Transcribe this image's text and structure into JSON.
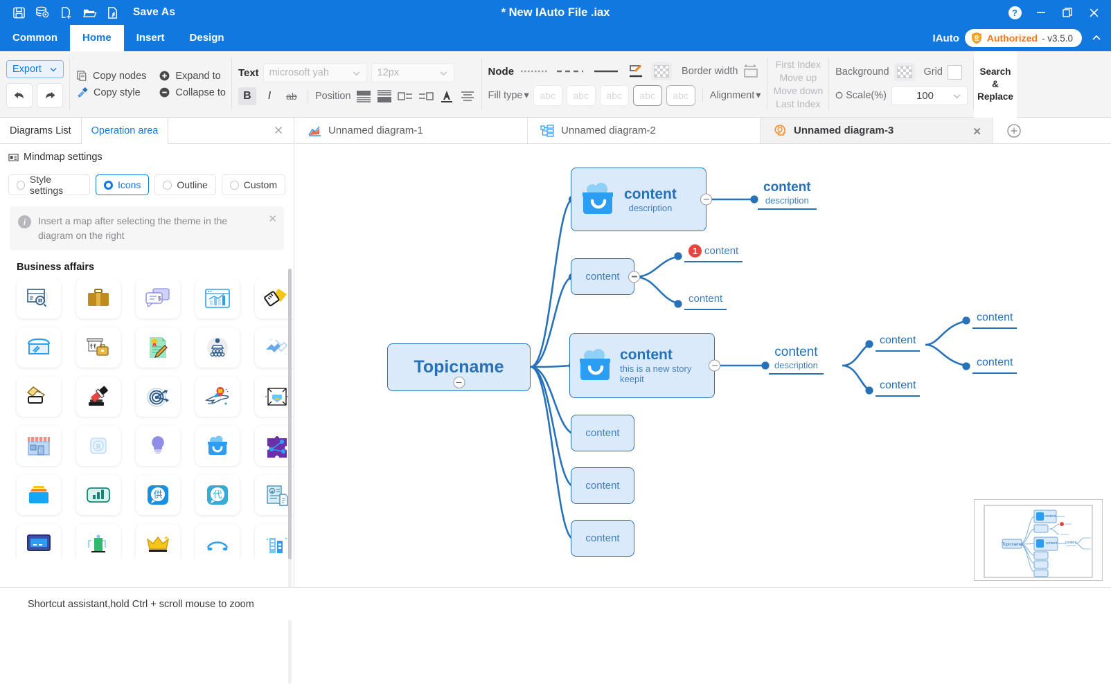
{
  "titlebar": {
    "save_as": "Save As",
    "window_title": "* New IAuto File .iax",
    "icons": [
      "save-icon",
      "database-settings-icon",
      "new-file-icon",
      "open-folder-icon",
      "import-icon"
    ],
    "controls": [
      "help-icon",
      "minimize-icon",
      "restore-icon",
      "close-icon"
    ]
  },
  "menubar": {
    "items": [
      {
        "label": "Common",
        "active": false
      },
      {
        "label": "Home",
        "active": true
      },
      {
        "label": "Insert",
        "active": false
      },
      {
        "label": "Design",
        "active": false
      }
    ],
    "brand": "IAuto",
    "auth_label": "Authorized",
    "version": "- v3.5.0",
    "auth_color": "#f5761a"
  },
  "ribbon": {
    "export_label": "Export",
    "undo_icon": "undo-icon",
    "redo_icon": "redo-icon",
    "copy_nodes": "Copy nodes",
    "copy_style": "Copy style",
    "expand_to": "Expand to",
    "collapse_to": "Collapse to",
    "text_label": "Text",
    "font_family": "microsoft yah",
    "font_size": "12px",
    "bold": "B",
    "italic": "I",
    "strike": "ab",
    "position_label": "Position",
    "node_label": "Node",
    "border_width_label": "Border width",
    "fill_type_label": "Fill type",
    "fill_samples": [
      "abc",
      "abc",
      "abc",
      "abc",
      "abc"
    ],
    "alignment_label": "Alignment",
    "index_items": [
      "First Index",
      "Move up",
      "Move down",
      "Last Index"
    ],
    "background_label": "Background",
    "grid_label": "Grid",
    "scale_label": "Scale(%)",
    "scale_value": "100",
    "search_replace": "Search\n&\nReplace"
  },
  "leftpanel": {
    "tabs": [
      {
        "label": "Diagrams List",
        "active": false
      },
      {
        "label": "Operation area",
        "active": true
      }
    ],
    "settings_title": "Mindmap settings",
    "radios": [
      {
        "label": "Style settings",
        "selected": false
      },
      {
        "label": "Icons",
        "selected": true
      },
      {
        "label": "Outline",
        "selected": false
      },
      {
        "label": "Custom",
        "selected": false
      }
    ],
    "notice": "Insert a map after selecting the theme in the diagram on the right",
    "category": "Business affairs",
    "icons": [
      "package-search-icon",
      "briefcase-icon",
      "chat-invoice-icon",
      "chart-window-icon",
      "paint-brush-icon",
      "storefront-edit-icon",
      "archive-box-briefcase-icon",
      "certificate-pen-icon",
      "podium-speaker-icon",
      "puzzle-pieces-icon",
      "color-swatch-icon",
      "gavel-icon",
      "target-dart-icon",
      "airplane-location-icon",
      "shipping-box-icon",
      "shop-awning-icon",
      "registered-r-icon",
      "lightbulb-icon",
      "smile-bag-icon",
      "purple-puzzle-icon",
      "file-drawer-icon",
      "bar-chart-rounded-icon",
      "supply-chinese-icon",
      "agent-chinese-icon",
      "document-lock-icon",
      "monitor-icon",
      "gas-station-icon",
      "crown-icon",
      "arc-arrow-icon",
      "buildings-icon"
    ]
  },
  "statusbar": {
    "hint": "Shortcut assistant,hold Ctrl + scroll mouse to zoom"
  },
  "canvas_tabs": [
    {
      "label": "Unnamed diagram-1",
      "icon": "area-chart-icon",
      "active": false
    },
    {
      "label": "Unnamed diagram-2",
      "icon": "org-tree-icon",
      "active": false
    },
    {
      "label": "Unnamed diagram-3",
      "icon": "mindmap-head-icon",
      "active": true
    }
  ],
  "mindmap": {
    "root": {
      "title": "Topicname"
    },
    "branch1": {
      "title": "content",
      "description": "description"
    },
    "branch1_child": {
      "title": "content",
      "description": "description"
    },
    "branch2": {
      "title": "content"
    },
    "branch2_child1": {
      "title": "content",
      "badge": "1"
    },
    "branch2_child2": {
      "title": "content"
    },
    "branch3": {
      "title": "content",
      "description_line1": "this is a  new story",
      "description_line2": "keepit"
    },
    "branch3_child": {
      "title": "content",
      "description": "description"
    },
    "branch3_gc1": {
      "title": "content"
    },
    "branch3_gc2": {
      "title": "content"
    },
    "branch3_ggc1": {
      "title": "content"
    },
    "branch3_ggc2": {
      "title": "content"
    },
    "branch4": {
      "title": "content"
    },
    "branch5": {
      "title": "content"
    },
    "branch6": {
      "title": "content"
    },
    "colors": {
      "node_border": "#2671b8",
      "node_fill": "#dbeafb",
      "text": "#2671b8",
      "badge": "#e8453c"
    }
  }
}
